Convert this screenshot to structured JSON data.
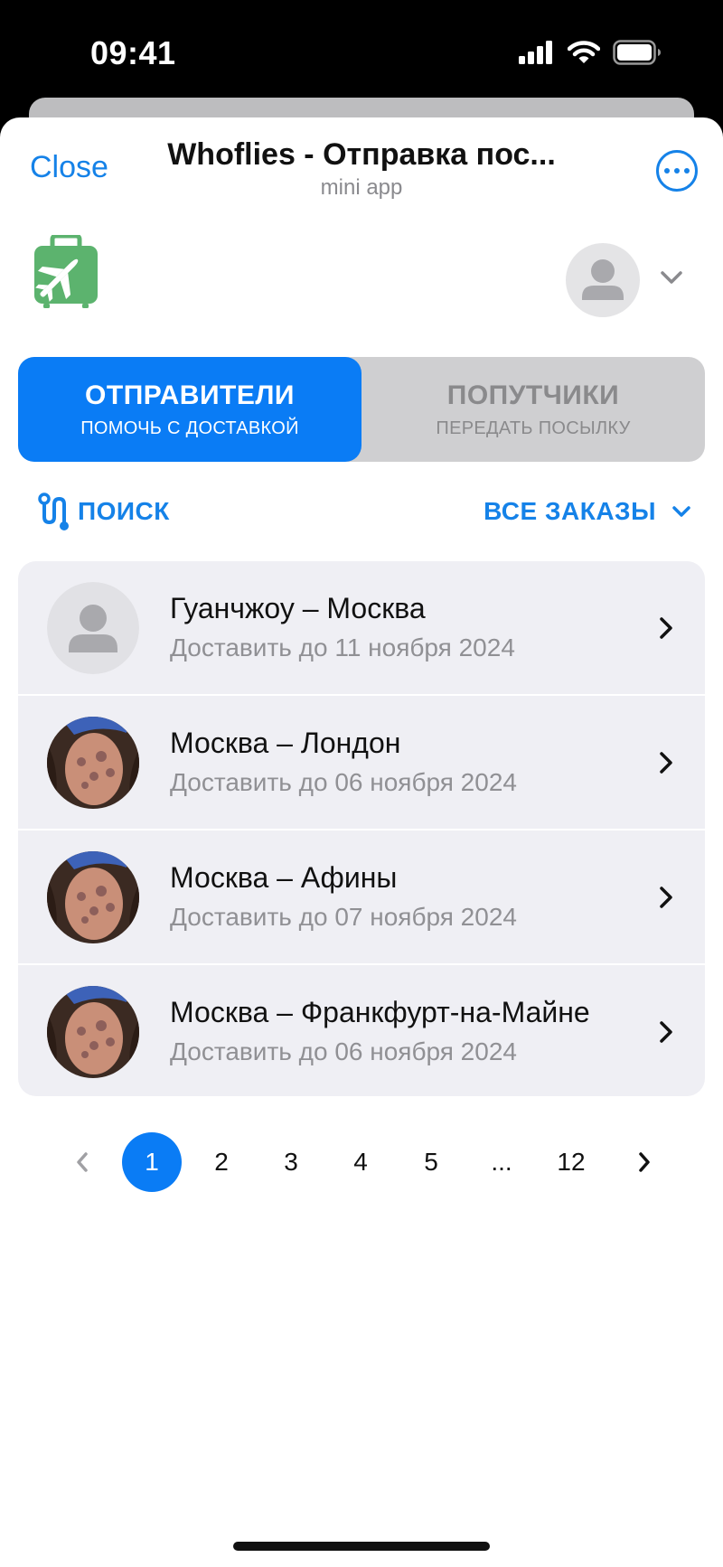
{
  "status_bar": {
    "time": "09:41"
  },
  "header": {
    "close_label": "Close",
    "title": "Whoflies - Отправка пос...",
    "subtitle": "mini app"
  },
  "colors": {
    "accent": "#0a7cf5",
    "link": "#1582e8",
    "logo_green": "#5cb36e",
    "list_bg": "#efeff4"
  },
  "tabs": [
    {
      "label": "ОТПРАВИТЕЛИ",
      "sublabel": "ПОМОЧЬ С ДОСТАВКОЙ",
      "active": true
    },
    {
      "label": "ПОПУТЧИКИ",
      "sublabel": "ПЕРЕДАТЬ ПОСЫЛКУ",
      "active": false
    }
  ],
  "toolbar": {
    "search_label": "ПОИСК",
    "filter_label": "ВСЕ ЗАКАЗЫ"
  },
  "orders": [
    {
      "route": "Гуанчжоу – Москва",
      "date": "Доставить до 11 ноября 2024",
      "avatar": "placeholder"
    },
    {
      "route": "Москва – Лондон",
      "date": "Доставить до 06 ноября 2024",
      "avatar": "photo"
    },
    {
      "route": "Москва – Афины",
      "date": "Доставить до 07 ноября 2024",
      "avatar": "photo"
    },
    {
      "route": "Москва – Франкфурт-на-Майне",
      "date": "Доставить до 06 ноября 2024",
      "avatar": "photo"
    }
  ],
  "pagination": {
    "current": "1",
    "pages": [
      "1",
      "2",
      "3",
      "4",
      "5",
      "...",
      "12"
    ]
  }
}
